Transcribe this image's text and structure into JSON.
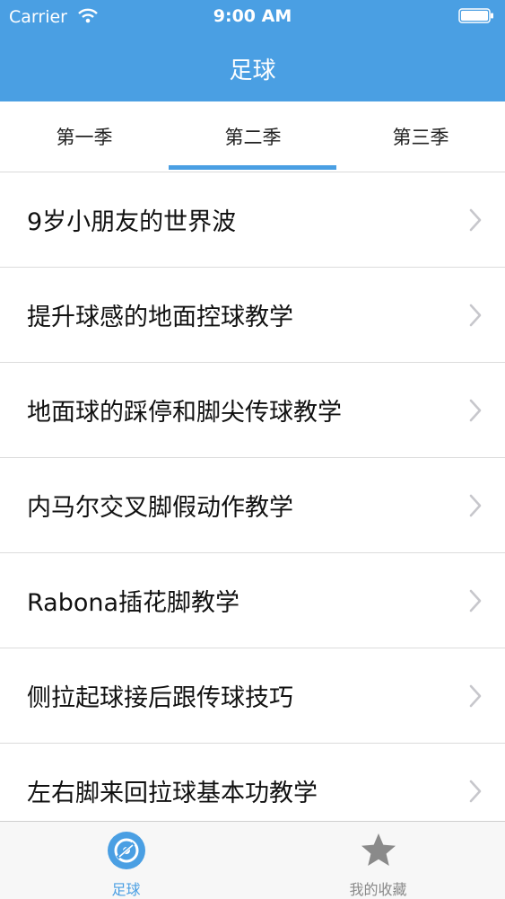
{
  "status_bar": {
    "carrier": "Carrier",
    "time": "9:00 AM",
    "wifi_icon": "wifi-icon",
    "battery_icon": "battery-icon"
  },
  "nav": {
    "title": "足球"
  },
  "segments": {
    "items": [
      {
        "label": "第一季"
      },
      {
        "label": "第二季"
      },
      {
        "label": "第三季"
      }
    ],
    "selected": "第二季"
  },
  "list": {
    "items": [
      {
        "label": "9岁小朋友的世界波"
      },
      {
        "label": "提升球感的地面控球教学"
      },
      {
        "label": "地面球的踩停和脚尖传球教学"
      },
      {
        "label": "内马尔交叉脚假动作教学"
      },
      {
        "label": "Rabona插花脚教学"
      },
      {
        "label": "侧拉起球接后跟传球技巧"
      },
      {
        "label": "左右脚来回拉球基本功教学"
      }
    ],
    "chevron_icon": "chevron-right-icon"
  },
  "tabbar": {
    "items": [
      {
        "label": "足球",
        "icon": "disc-icon"
      },
      {
        "label": "我的收藏",
        "icon": "star-icon"
      }
    ],
    "selected": "足球"
  },
  "colors": {
    "accent": "#4a9fe3",
    "inactive": "#8a8a8a",
    "chevron": "#c7c7cc"
  }
}
